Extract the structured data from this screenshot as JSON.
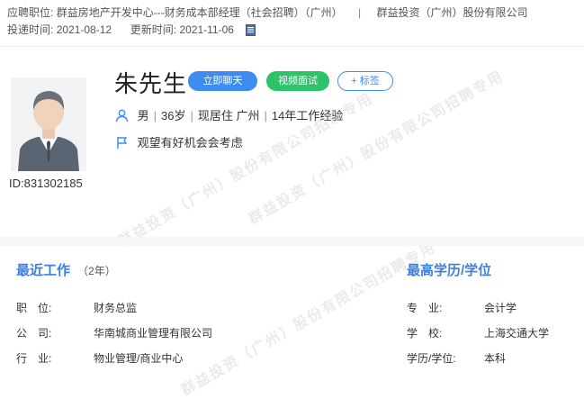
{
  "header": {
    "position_label": "应聘职位:",
    "position_value": "群益房地产开发中心---财务成本部经理（社会招聘）（广州）",
    "company": "群益投资（广州）股份有限公司",
    "apply_label": "投递时间:",
    "apply_date": "2021-08-12",
    "update_label": "更新时间:",
    "update_date": "2021-11-06",
    "doc_icon": "document-icon"
  },
  "candidate": {
    "name": "朱先生",
    "id_text": "ID:831302185",
    "gender": "男",
    "age": "36岁",
    "residence": "现居住 广州",
    "experience": "14年工作经验",
    "job_status": "观望有好机会会考虑",
    "chat_label": "立即聊天",
    "video_label": "视频面试",
    "tag_label": "+ 标签"
  },
  "work": {
    "title": "最近工作",
    "years": "（2年）",
    "rows": [
      {
        "key": "职　位:",
        "value": "财务总监"
      },
      {
        "key": "公　司:",
        "value": "华南城商业管理有限公司"
      },
      {
        "key": "行　业:",
        "value": "物业管理/商业中心"
      }
    ]
  },
  "education": {
    "title": "最高学历/学位",
    "rows": [
      {
        "key": "专　业:",
        "value": "会计学"
      },
      {
        "key": "学　校:",
        "value": "上海交通大学"
      },
      {
        "key": "学历/学位:",
        "value": "本科"
      }
    ]
  },
  "watermark": {
    "line1": "群益投资（广州）股份有限公司招聘专用"
  },
  "colors": {
    "accent": "#3d8cf0",
    "video": "#2cc36b",
    "section_title": "#3d7fe0"
  }
}
